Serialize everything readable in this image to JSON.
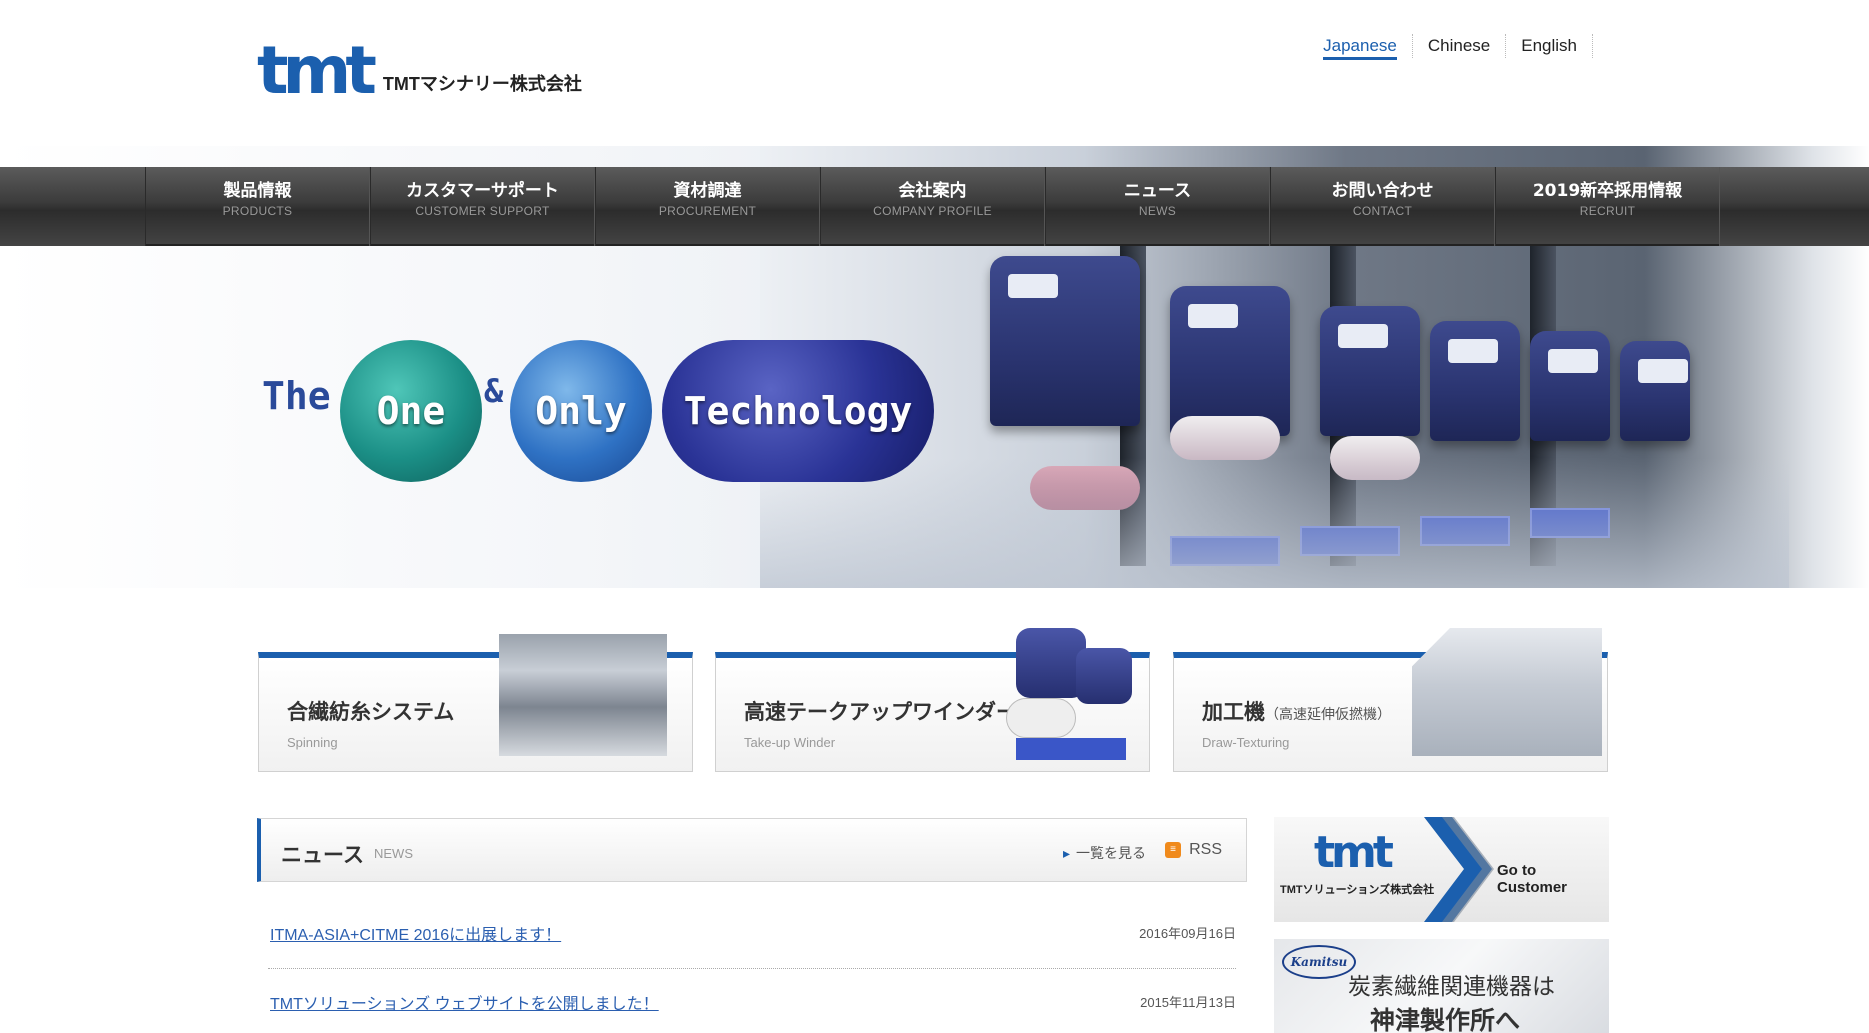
{
  "header": {
    "logo_mark": "tmt",
    "logo_text": "TMTマシナリー株式会社",
    "languages": [
      {
        "label": "Japanese",
        "active": true
      },
      {
        "label": "Chinese",
        "active": false
      },
      {
        "label": "English",
        "active": false
      }
    ]
  },
  "nav": [
    {
      "jp": "製品情報",
      "en": "PRODUCTS"
    },
    {
      "jp": "カスタマーサポート",
      "en": "CUSTOMER SUPPORT"
    },
    {
      "jp": "資材調達",
      "en": "PROCUREMENT"
    },
    {
      "jp": "会社案内",
      "en": "COMPANY PROFILE"
    },
    {
      "jp": "ニュース",
      "en": "NEWS"
    },
    {
      "jp": "お問い合わせ",
      "en": "CONTACT"
    },
    {
      "jp": "2019新卒採用情報",
      "en": "RECRUIT"
    }
  ],
  "hero": {
    "word_the": "The",
    "word_one": "One",
    "word_amp": "&",
    "word_only": "Only",
    "word_tech": "Technology"
  },
  "products": [
    {
      "title": "合繊紡糸システム",
      "title_note": "",
      "subtitle": "Spinning"
    },
    {
      "title": "高速テークアップワインダー",
      "title_note": "",
      "subtitle": "Take-up Winder"
    },
    {
      "title": "加工機",
      "title_note": "（高速延伸仮撚機）",
      "subtitle": "Draw-Texturing"
    }
  ],
  "news": {
    "title": "ニュース",
    "title_en": "NEWS",
    "more_label": "一覧を見る",
    "rss_label": "RSS",
    "items": [
      {
        "title": "ITMA-ASIA+CITME 2016に出展します！",
        "date": "2016年09月16日"
      },
      {
        "title": "TMTソリューションズ ウェブサイトを公開しました！",
        "date": "2015年11月13日"
      }
    ]
  },
  "banners": {
    "solutions_logo": "tmt",
    "solutions_company": "TMTソリューションズ株式会社",
    "solutions_cta": "Go to Customer",
    "kamitsu_badge": "Kamitsu",
    "kamitsu_line1": "炭素繊維関連機器は",
    "kamitsu_line2": "神津製作所へ"
  },
  "colors": {
    "brand_blue": "#1b5fae",
    "nav_dark": "#3b3b3b",
    "link_blue": "#2b5fb0",
    "rss_orange": "#f08a1c"
  }
}
